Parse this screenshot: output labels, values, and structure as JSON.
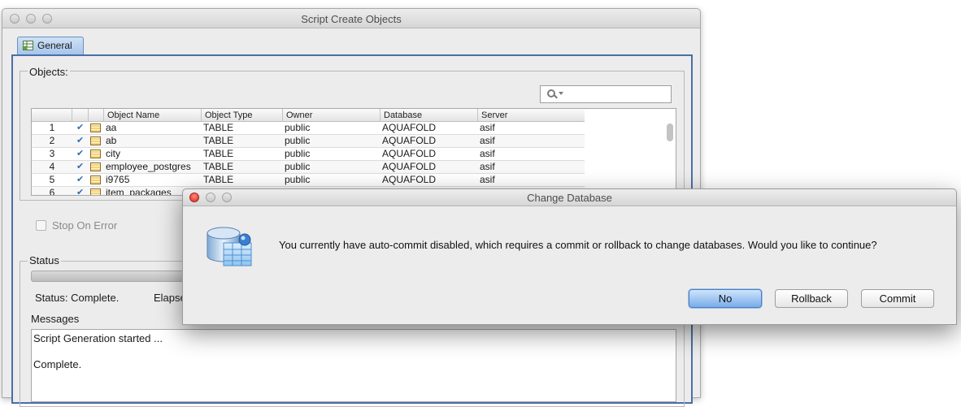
{
  "window": {
    "title": "Script Create Objects",
    "tab_general": "General",
    "objects": {
      "legend": "Objects:",
      "search_placeholder": "",
      "columns": [
        "",
        "",
        "",
        "Object Name",
        "Object Type",
        "Owner",
        "Database",
        "Server"
      ],
      "rows": [
        {
          "num": "1",
          "name": "aa",
          "type": "TABLE",
          "owner": "public",
          "database": "AQUAFOLD",
          "server": "asif"
        },
        {
          "num": "2",
          "name": "ab",
          "type": "TABLE",
          "owner": "public",
          "database": "AQUAFOLD",
          "server": "asif"
        },
        {
          "num": "3",
          "name": "city",
          "type": "TABLE",
          "owner": "public",
          "database": "AQUAFOLD",
          "server": "asif"
        },
        {
          "num": "4",
          "name": "employee_postgres",
          "type": "TABLE",
          "owner": "public",
          "database": "AQUAFOLD",
          "server": "asif"
        },
        {
          "num": "5",
          "name": "i9765",
          "type": "TABLE",
          "owner": "public",
          "database": "AQUAFOLD",
          "server": "asif"
        },
        {
          "num": "6",
          "name": "item_packages",
          "type": "",
          "owner": "",
          "database": "",
          "server": ""
        }
      ],
      "check_glyph": "✔"
    },
    "stop_on_error": "Stop On Error",
    "status": {
      "legend": "Status",
      "status_text": "Status: Complete.",
      "elapsed_text": "Elapse",
      "messages_label": "Messages",
      "messages": [
        "Script Generation started ...",
        "",
        "Complete."
      ]
    }
  },
  "dialog": {
    "title": "Change Database",
    "message": "You currently have auto-commit disabled, which requires a commit or rollback to change databases. Would you like to continue?",
    "buttons": {
      "no": "No",
      "rollback": "Rollback",
      "commit": "Commit"
    },
    "icon": "database-icon"
  },
  "colors": {
    "accent_blue": "#4a6ea8",
    "default_button": "#78acea",
    "close_red": "#d9261a"
  }
}
